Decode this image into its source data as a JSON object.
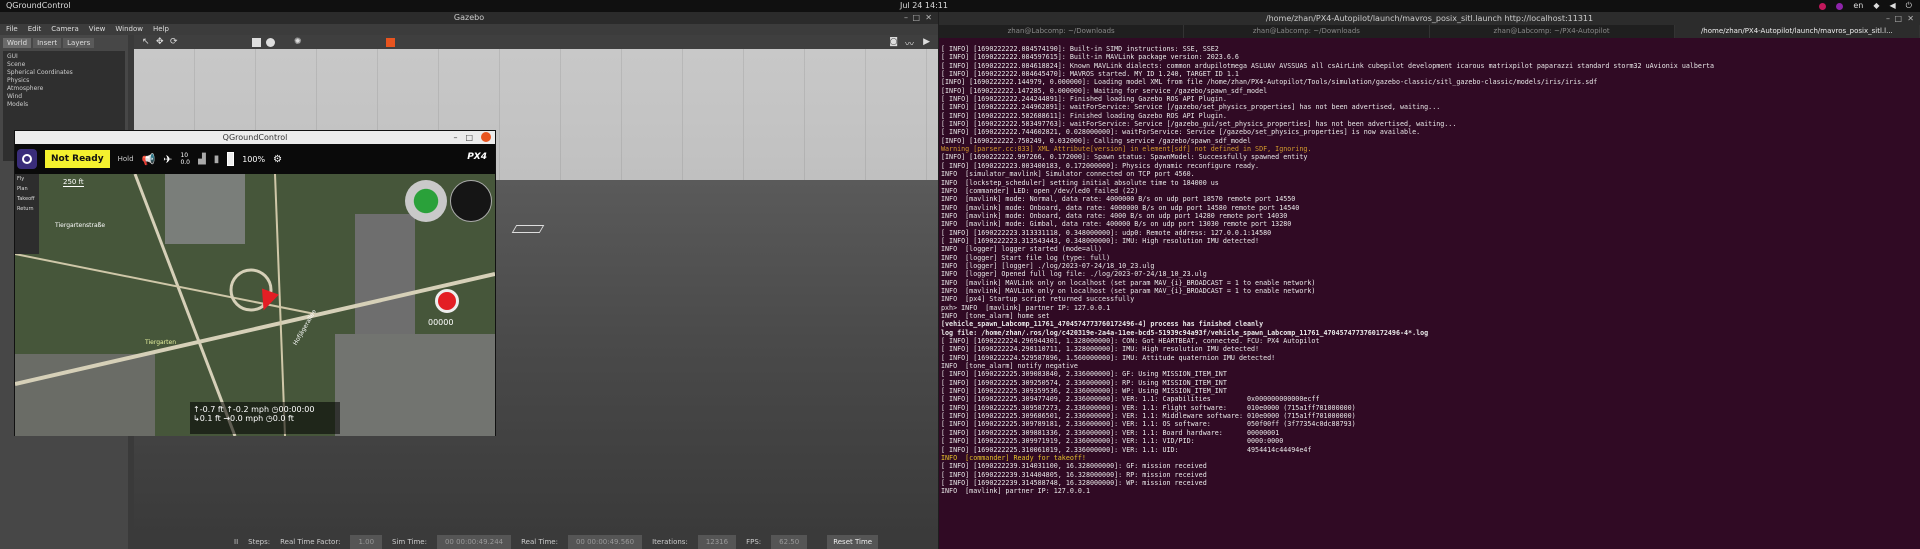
{
  "topbar": {
    "app": "QGroundControl",
    "clock": "Jul 24  14:11",
    "lang": "en"
  },
  "gazebo": {
    "title": "Gazebo",
    "menu": [
      "File",
      "Edit",
      "Camera",
      "View",
      "Window",
      "Help"
    ],
    "tabs": [
      "World",
      "Insert",
      "Layers"
    ],
    "tree": [
      "GUI",
      "Scene",
      "Spherical Coordinates",
      "Physics",
      "Atmosphere",
      "Wind",
      "Models"
    ],
    "status": {
      "pause": "II",
      "steps_label": "Steps:",
      "rtf_label": "Real Time Factor:",
      "rtf_value": "1.00",
      "simtime_label": "Sim Time:",
      "simtime_value": "00 00:00:49.244",
      "realtime_label": "Real Time:",
      "realtime_value": "00 00:00:49.560",
      "iter_label": "Iterations:",
      "iter_value": "12316",
      "fps_label": "FPS:",
      "fps_value": "62.50",
      "reset": "Reset Time"
    }
  },
  "qgc": {
    "title": "QGroundControl",
    "state": "Not Ready",
    "mode": "Hold",
    "battery": "100%",
    "gps_count": "10",
    "gps_hdop": "0.0",
    "scale": "250 ft",
    "side": [
      "Fly",
      "Plan",
      "Takeoff",
      "Return"
    ],
    "video_timer": "00000",
    "telemetry": {
      "alt_rel": "-0.7 ft",
      "alt_amsl": "-0.2 mph",
      "time": "00:00:00",
      "dist": "0.1 ft",
      "speed": "0.0 mph",
      "dist2": "0.0 ft"
    },
    "map_labels": [
      "Tiergarten",
      "Tiergartenstraße",
      "Strasse des 17 Juni",
      "Großer Stern",
      "Hofjägerallee"
    ]
  },
  "terminal": {
    "title": "/home/zhan/PX4-Autopilot/launch/mavros_posix_sitl.launch http://localhost:11311",
    "tabs": [
      "zhan@Labcomp: ~/Downloads",
      "zhan@Labcomp: ~/Downloads",
      "zhan@Labcomp: ~/PX4-Autopilot",
      "/home/zhan/PX4-Autopilot/launch/mavros_posix_sitl.l..."
    ],
    "lines": [
      {
        "t": "[ INFO] [1690222222.084574190]: Built-in SIMD instructions: SSE, SSE2",
        "c": ""
      },
      {
        "t": "[ INFO] [1690222222.084597615]: Built-in MAVLink package version: 2023.6.6",
        "c": ""
      },
      {
        "t": "[ INFO] [1690222222.084618824]: Known MAVLink dialects: common ardupilotmega ASLUAV AVSSUAS all csAirLink cubepilot development icarous matrixpilot paparazzi standard storm32 uAvionix ualberta",
        "c": ""
      },
      {
        "t": "[ INFO] [1690222222.084645470]: MAVROS started. MY ID 1.240, TARGET ID 1.1",
        "c": ""
      },
      {
        "t": "[INFO] [1690222222.144979, 0.000000]: Loading model XML from file /home/zhan/PX4-Autopilot/Tools/simulation/gazebo-classic/sitl_gazebo-classic/models/iris/iris.sdf",
        "c": ""
      },
      {
        "t": "[INFO] [1690222222.147285, 0.000000]: Waiting for service /gazebo/spawn_sdf_model",
        "c": ""
      },
      {
        "t": "[ INFO] [1690222222.244244891]: Finished loading Gazebo ROS API Plugin.",
        "c": ""
      },
      {
        "t": "[ INFO] [1690222222.244962891]: waitForService: Service [/gazebo/set_physics_properties] has not been advertised, waiting...",
        "c": ""
      },
      {
        "t": "[ INFO] [1690222222.582688611]: Finished loading Gazebo ROS API Plugin.",
        "c": ""
      },
      {
        "t": "[ INFO] [1690222222.583497763]: waitForService: Service [/gazebo_gui/set_physics_properties] has not been advertised, waiting...",
        "c": ""
      },
      {
        "t": "[ INFO] [1690222222.744602821, 0.028000000]: waitForService: Service [/gazebo/set_physics_properties] is now available.",
        "c": ""
      },
      {
        "t": "[INFO] [1690222222.750249, 0.032000]: Calling service /gazebo/spawn_sdf_model",
        "c": ""
      },
      {
        "t": "Warning [parser.cc:833] XML Attribute[version] in element[sdf] not defined in SDF, Ignoring.",
        "c": "warn"
      },
      {
        "t": "[INFO] [1690222222.997266, 0.172000]: Spawn status: SpawnModel: Successfully spawned entity",
        "c": ""
      },
      {
        "t": "[ INFO] [1690222223.003400183, 0.172000000]: Physics dynamic reconfigure ready.",
        "c": ""
      },
      {
        "t": "INFO  [simulator_mavlink] Simulator connected on TCP port 4560.",
        "c": ""
      },
      {
        "t": "INFO  [lockstep_scheduler] setting initial absolute time to 184000 us",
        "c": ""
      },
      {
        "t": "INFO  [commander] LED: open /dev/led0 failed (22)",
        "c": ""
      },
      {
        "t": "INFO  [mavlink] mode: Normal, data rate: 4000000 B/s on udp port 18570 remote port 14550",
        "c": ""
      },
      {
        "t": "INFO  [mavlink] mode: Onboard, data rate: 4000000 B/s on udp port 14580 remote port 14540",
        "c": ""
      },
      {
        "t": "INFO  [mavlink] mode: Onboard, data rate: 4000 B/s on udp port 14280 remote port 14030",
        "c": ""
      },
      {
        "t": "INFO  [mavlink] mode: Gimbal, data rate: 400000 B/s on udp port 13030 remote port 13280",
        "c": ""
      },
      {
        "t": "[ INFO] [1690222223.313331118, 0.348000000]: udp0: Remote address: 127.0.0.1:14580",
        "c": ""
      },
      {
        "t": "[ INFO] [1690222223.313543443, 0.348000000]: IMU: High resolution IMU detected!",
        "c": ""
      },
      {
        "t": "INFO  [logger] logger started (mode=all)",
        "c": ""
      },
      {
        "t": "INFO  [logger] Start file log (type: full)",
        "c": ""
      },
      {
        "t": "INFO  [logger] [logger] ./log/2023-07-24/18_10_23.ulg",
        "c": ""
      },
      {
        "t": "INFO  [logger] Opened full log file: ./log/2023-07-24/18_10_23.ulg",
        "c": ""
      },
      {
        "t": "INFO  [mavlink] MAVLink only on localhost (set param MAV_{i}_BROADCAST = 1 to enable network)",
        "c": ""
      },
      {
        "t": "INFO  [mavlink] MAVLink only on localhost (set param MAV_{i}_BROADCAST = 1 to enable network)",
        "c": ""
      },
      {
        "t": "INFO  [px4] Startup script returned successfully",
        "c": ""
      },
      {
        "t": "pxh> INFO  [mavlink] partner IP: 127.0.0.1",
        "c": ""
      },
      {
        "t": "INFO  [tone_alarm] home set",
        "c": ""
      },
      {
        "t": "[vehicle_spawn_Labcomp_11761_4704574773760172496-4] process has finished cleanly",
        "c": "bold"
      },
      {
        "t": "log file: /home/zhan/.ros/log/c420319e-2a4a-11ee-bcd5-51939c94a93f/vehicle_spawn_Labcomp_11761_4704574773760172496-4*.log",
        "c": "bold"
      },
      {
        "t": "[ INFO] [1690222224.296944301, 1.328000000]: CON: Got HEARTBEAT, connected. FCU: PX4 Autopilot",
        "c": ""
      },
      {
        "t": "[ INFO] [1690222224.298110711, 1.328000000]: IMU: High resolution IMU detected!",
        "c": ""
      },
      {
        "t": "[ INFO] [1690222224.529587896, 1.560000000]: IMU: Attitude quaternion IMU detected!",
        "c": ""
      },
      {
        "t": "INFO  [tone_alarm] notify negative",
        "c": ""
      },
      {
        "t": "[ INFO] [1690222225.309083840, 2.336000000]: GF: Using MISSION_ITEM_INT",
        "c": ""
      },
      {
        "t": "[ INFO] [1690222225.309250574, 2.336000000]: RP: Using MISSION_ITEM_INT",
        "c": ""
      },
      {
        "t": "[ INFO] [1690222225.309359536, 2.336000000]: WP: Using MISSION_ITEM_INT",
        "c": ""
      },
      {
        "t": "[ INFO] [1690222225.309477409, 2.336000000]: VER: 1.1: Capabilities         0x000000000000ecff",
        "c": ""
      },
      {
        "t": "[ INFO] [1690222225.309587273, 2.336000000]: VER: 1.1: Flight software:     010e0000 (715a1ff701000000)",
        "c": ""
      },
      {
        "t": "[ INFO] [1690222225.309686501, 2.336000000]: VER: 1.1: Middleware software: 010e0000 (715a1ff701000000)",
        "c": ""
      },
      {
        "t": "[ INFO] [1690222225.309789181, 2.336000000]: VER: 1.1: OS software:         050f00ff (3f77354c0dc88793)",
        "c": ""
      },
      {
        "t": "[ INFO] [1690222225.309881336, 2.336000000]: VER: 1.1: Board hardware:      00000001",
        "c": ""
      },
      {
        "t": "[ INFO] [1690222225.309971919, 2.336000000]: VER: 1.1: VID/PID:             0000:0000",
        "c": ""
      },
      {
        "t": "[ INFO] [1690222225.310061019, 2.336000000]: VER: 1.1: UID:                 4954414c44494e4f",
        "c": ""
      },
      {
        "t": "INFO  [commander] Ready for takeoff!",
        "c": "yel"
      },
      {
        "t": "[ INFO] [1690222239.314031100, 16.328000000]: GF: mission received",
        "c": ""
      },
      {
        "t": "[ INFO] [1690222239.314404805, 16.328000000]: RP: mission received",
        "c": ""
      },
      {
        "t": "[ INFO] [1690222239.314588748, 16.328000000]: WP: mission received",
        "c": ""
      },
      {
        "t": "INFO  [mavlink] partner IP: 127.0.0.1",
        "c": ""
      }
    ]
  }
}
